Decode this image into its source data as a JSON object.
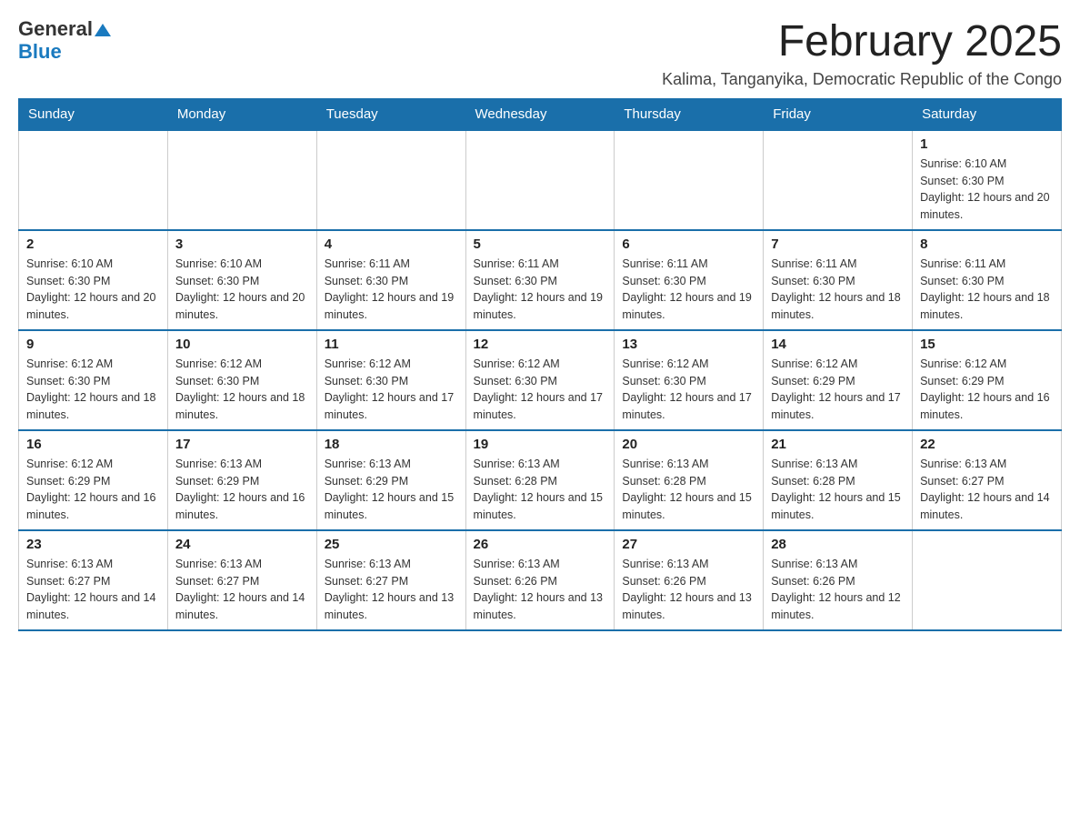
{
  "logo": {
    "general": "General",
    "blue": "Blue"
  },
  "header": {
    "title": "February 2025",
    "subtitle": "Kalima, Tanganyika, Democratic Republic of the Congo"
  },
  "weekdays": [
    "Sunday",
    "Monday",
    "Tuesday",
    "Wednesday",
    "Thursday",
    "Friday",
    "Saturday"
  ],
  "weeks": [
    [
      {
        "day": "",
        "info": ""
      },
      {
        "day": "",
        "info": ""
      },
      {
        "day": "",
        "info": ""
      },
      {
        "day": "",
        "info": ""
      },
      {
        "day": "",
        "info": ""
      },
      {
        "day": "",
        "info": ""
      },
      {
        "day": "1",
        "info": "Sunrise: 6:10 AM\nSunset: 6:30 PM\nDaylight: 12 hours and 20 minutes."
      }
    ],
    [
      {
        "day": "2",
        "info": "Sunrise: 6:10 AM\nSunset: 6:30 PM\nDaylight: 12 hours and 20 minutes."
      },
      {
        "day": "3",
        "info": "Sunrise: 6:10 AM\nSunset: 6:30 PM\nDaylight: 12 hours and 20 minutes."
      },
      {
        "day": "4",
        "info": "Sunrise: 6:11 AM\nSunset: 6:30 PM\nDaylight: 12 hours and 19 minutes."
      },
      {
        "day": "5",
        "info": "Sunrise: 6:11 AM\nSunset: 6:30 PM\nDaylight: 12 hours and 19 minutes."
      },
      {
        "day": "6",
        "info": "Sunrise: 6:11 AM\nSunset: 6:30 PM\nDaylight: 12 hours and 19 minutes."
      },
      {
        "day": "7",
        "info": "Sunrise: 6:11 AM\nSunset: 6:30 PM\nDaylight: 12 hours and 18 minutes."
      },
      {
        "day": "8",
        "info": "Sunrise: 6:11 AM\nSunset: 6:30 PM\nDaylight: 12 hours and 18 minutes."
      }
    ],
    [
      {
        "day": "9",
        "info": "Sunrise: 6:12 AM\nSunset: 6:30 PM\nDaylight: 12 hours and 18 minutes."
      },
      {
        "day": "10",
        "info": "Sunrise: 6:12 AM\nSunset: 6:30 PM\nDaylight: 12 hours and 18 minutes."
      },
      {
        "day": "11",
        "info": "Sunrise: 6:12 AM\nSunset: 6:30 PM\nDaylight: 12 hours and 17 minutes."
      },
      {
        "day": "12",
        "info": "Sunrise: 6:12 AM\nSunset: 6:30 PM\nDaylight: 12 hours and 17 minutes."
      },
      {
        "day": "13",
        "info": "Sunrise: 6:12 AM\nSunset: 6:30 PM\nDaylight: 12 hours and 17 minutes."
      },
      {
        "day": "14",
        "info": "Sunrise: 6:12 AM\nSunset: 6:29 PM\nDaylight: 12 hours and 17 minutes."
      },
      {
        "day": "15",
        "info": "Sunrise: 6:12 AM\nSunset: 6:29 PM\nDaylight: 12 hours and 16 minutes."
      }
    ],
    [
      {
        "day": "16",
        "info": "Sunrise: 6:12 AM\nSunset: 6:29 PM\nDaylight: 12 hours and 16 minutes."
      },
      {
        "day": "17",
        "info": "Sunrise: 6:13 AM\nSunset: 6:29 PM\nDaylight: 12 hours and 16 minutes."
      },
      {
        "day": "18",
        "info": "Sunrise: 6:13 AM\nSunset: 6:29 PM\nDaylight: 12 hours and 15 minutes."
      },
      {
        "day": "19",
        "info": "Sunrise: 6:13 AM\nSunset: 6:28 PM\nDaylight: 12 hours and 15 minutes."
      },
      {
        "day": "20",
        "info": "Sunrise: 6:13 AM\nSunset: 6:28 PM\nDaylight: 12 hours and 15 minutes."
      },
      {
        "day": "21",
        "info": "Sunrise: 6:13 AM\nSunset: 6:28 PM\nDaylight: 12 hours and 15 minutes."
      },
      {
        "day": "22",
        "info": "Sunrise: 6:13 AM\nSunset: 6:27 PM\nDaylight: 12 hours and 14 minutes."
      }
    ],
    [
      {
        "day": "23",
        "info": "Sunrise: 6:13 AM\nSunset: 6:27 PM\nDaylight: 12 hours and 14 minutes."
      },
      {
        "day": "24",
        "info": "Sunrise: 6:13 AM\nSunset: 6:27 PM\nDaylight: 12 hours and 14 minutes."
      },
      {
        "day": "25",
        "info": "Sunrise: 6:13 AM\nSunset: 6:27 PM\nDaylight: 12 hours and 13 minutes."
      },
      {
        "day": "26",
        "info": "Sunrise: 6:13 AM\nSunset: 6:26 PM\nDaylight: 12 hours and 13 minutes."
      },
      {
        "day": "27",
        "info": "Sunrise: 6:13 AM\nSunset: 6:26 PM\nDaylight: 12 hours and 13 minutes."
      },
      {
        "day": "28",
        "info": "Sunrise: 6:13 AM\nSunset: 6:26 PM\nDaylight: 12 hours and 12 minutes."
      },
      {
        "day": "",
        "info": ""
      }
    ]
  ]
}
